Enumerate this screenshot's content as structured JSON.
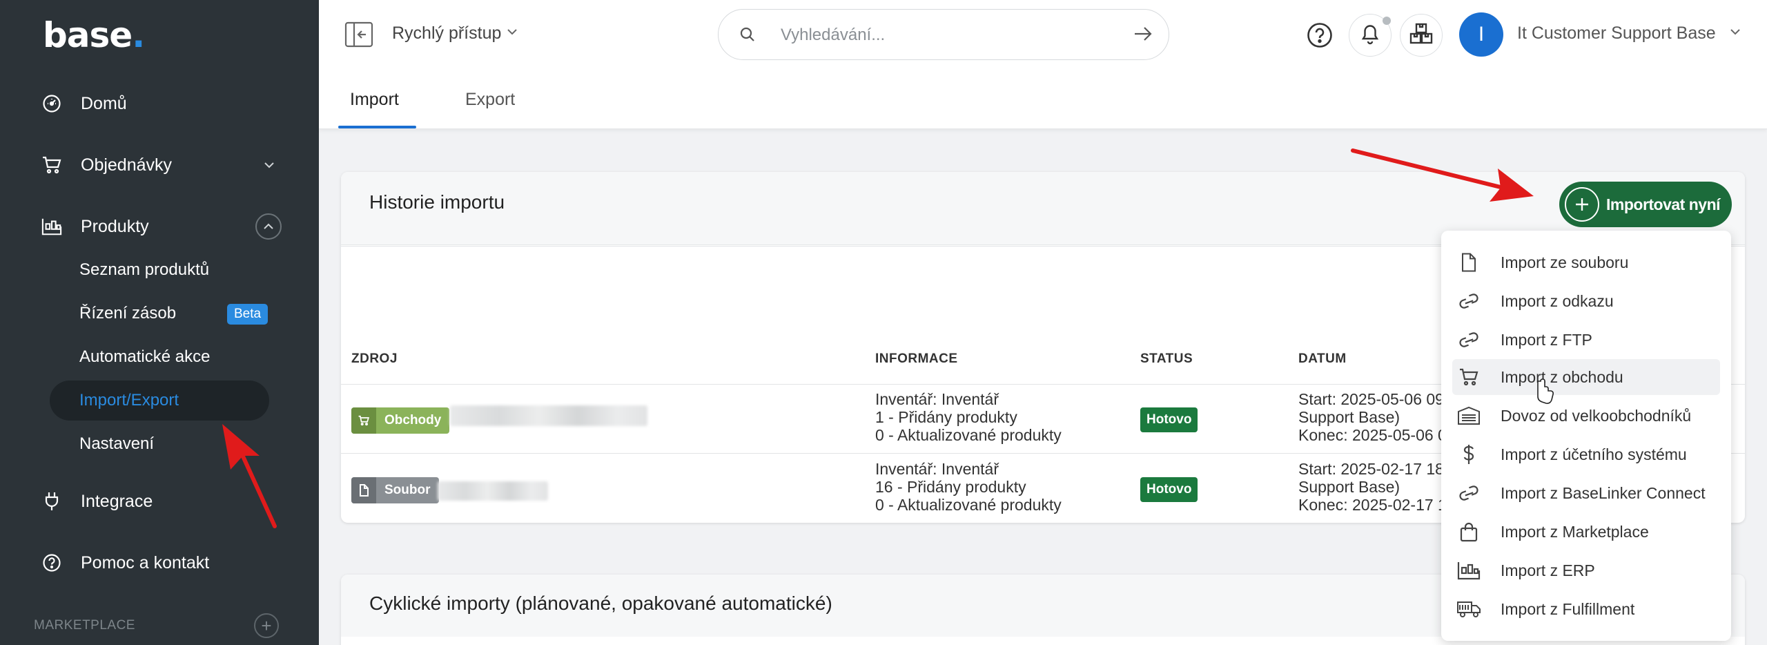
{
  "app": {
    "logo_text": "base",
    "logo_dot": "."
  },
  "sidebar": {
    "items": [
      {
        "label": "Domů",
        "icon": "dashboard-icon"
      },
      {
        "label": "Objednávky",
        "icon": "cart-icon"
      },
      {
        "label": "Produkty",
        "icon": "products-icon"
      },
      {
        "label": "Integrace",
        "icon": "plug-icon"
      },
      {
        "label": "Pomoc a kontakt",
        "icon": "help-icon"
      }
    ],
    "products_sub": [
      {
        "label": "Seznam produktů"
      },
      {
        "label": "Řízení zásob",
        "badge": "Beta"
      },
      {
        "label": "Automatické akce"
      },
      {
        "label": "Import/Export",
        "active": true
      },
      {
        "label": "Nastavení"
      }
    ],
    "marketplace_label": "MARKETPLACE"
  },
  "header": {
    "quick_access": "Rychlý přístup",
    "search_placeholder": "Vyhledávání...",
    "avatar_initial": "I",
    "account_name": "It Customer Support Base"
  },
  "tabs": [
    {
      "label": "Import",
      "active": true
    },
    {
      "label": "Export",
      "active": false
    }
  ],
  "history": {
    "title": "Historie importu",
    "columns": [
      "ZDROJ",
      "INFORMACE",
      "STATUS",
      "DATUM"
    ],
    "rows": [
      {
        "source": "Obchody",
        "source_color": "#8bb35a",
        "info": [
          "Inventář: Inventář",
          "1 - Přidány produkty",
          "0 - Aktualizované produkty"
        ],
        "status": "Hotovo",
        "date": [
          "Start: 2025-05-06 09",
          "Support Base)",
          "Konec: 2025-05-06 0"
        ]
      },
      {
        "source": "Soubor",
        "source_color": "#8a8f94",
        "info": [
          "Inventář: Inventář",
          "16 - Přidány produkty",
          "0 - Aktualizované produkty"
        ],
        "status": "Hotovo",
        "date": [
          "Start: 2025-02-17 18",
          "Support Base)",
          "Konec: 2025-02-17 1"
        ]
      }
    ]
  },
  "cyclic": {
    "title": "Cyklické importy (plánované, opakované automatické)"
  },
  "import_button": {
    "label": "Importovat nyní"
  },
  "import_menu": [
    {
      "label": "Import ze souboru",
      "icon": "file-icon"
    },
    {
      "label": "Import z odkazu",
      "icon": "link-icon"
    },
    {
      "label": "Import z FTP",
      "icon": "link-icon"
    },
    {
      "label": "Import z obchodu",
      "icon": "cart-icon",
      "hover": true
    },
    {
      "label": "Dovoz od velkoobchodníků",
      "icon": "wholesale-icon"
    },
    {
      "label": "Import z účetního systému",
      "icon": "dollar-icon"
    },
    {
      "label": "Import z BaseLinker Connect",
      "icon": "link-icon"
    },
    {
      "label": "Import z Marketplace",
      "icon": "bag-icon"
    },
    {
      "label": "Import z ERP",
      "icon": "factory-icon"
    },
    {
      "label": "Import z Fulfillment",
      "icon": "truck-icon"
    }
  ],
  "colors": {
    "sidebar_bg": "#2c3338",
    "accent_blue": "#1a6fd1",
    "success_green": "#1c6b3b",
    "annotation_red": "#e01b1b"
  }
}
